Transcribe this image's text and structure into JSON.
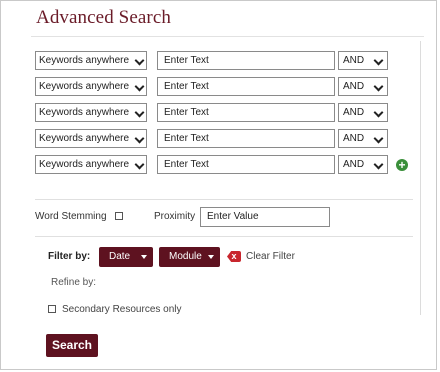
{
  "title": "Advanced Search",
  "search_rows": [
    {
      "field": "Keywords anywhere",
      "placeholder": "Enter Text",
      "operator": "AND"
    },
    {
      "field": "Keywords anywhere",
      "placeholder": "Enter Text",
      "operator": "AND"
    },
    {
      "field": "Keywords anywhere",
      "placeholder": "Enter Text",
      "operator": "AND"
    },
    {
      "field": "Keywords anywhere",
      "placeholder": "Enter Text",
      "operator": "AND"
    },
    {
      "field": "Keywords anywhere",
      "placeholder": "Enter Text",
      "operator": "AND"
    }
  ],
  "options": {
    "word_stemming_label": "Word Stemming",
    "proximity_label": "Proximity",
    "proximity_placeholder": "Enter Value"
  },
  "filters": {
    "filter_by_label": "Filter by:",
    "date_label": "Date",
    "module_label": "Module",
    "clear_filter_label": "Clear Filter",
    "clear_icon": "x",
    "refine_by_label": "Refine by:",
    "secondary_only_label": "Secondary Resources only"
  },
  "search_button": "Search",
  "icons": {
    "add_row": "+"
  },
  "colors": {
    "brand": "#5e1220",
    "title": "#6a1b28",
    "add": "#3a8f3a",
    "clear": "#c8262e"
  }
}
